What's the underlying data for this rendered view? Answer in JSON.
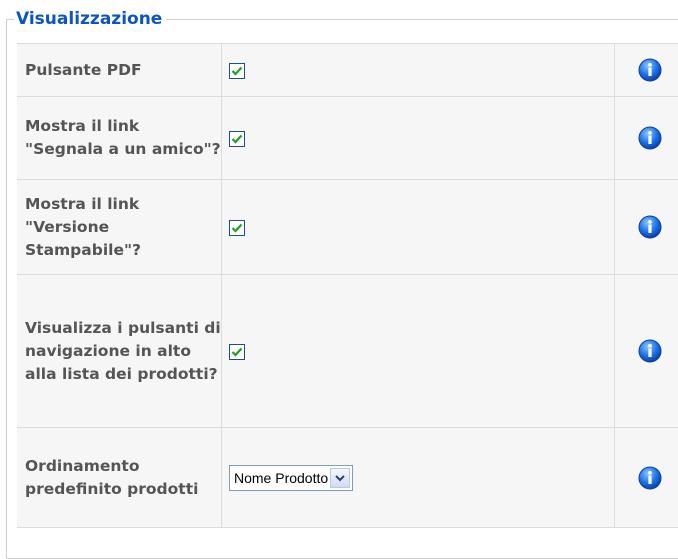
{
  "section": {
    "legend": "Visualizzazione"
  },
  "rows": [
    {
      "label": "Pulsante PDF",
      "control": "checkbox",
      "checked": true,
      "info_icon": "info-icon"
    },
    {
      "label": "Mostra il link \"Segnala a un amico\"?",
      "control": "checkbox",
      "checked": true,
      "info_icon": "info-icon"
    },
    {
      "label": "Mostra il link \"Versione Stampabile\"?",
      "control": "checkbox",
      "checked": true,
      "info_icon": "info-icon"
    },
    {
      "label": "Visualizza i pulsanti di navigazione in alto alla lista dei prodotti?",
      "control": "checkbox",
      "checked": true,
      "info_icon": "info-icon"
    },
    {
      "label": "Ordinamento predefinito prodotti",
      "control": "select",
      "selected": "Nome Prodotto",
      "info_icon": "info-icon"
    }
  ],
  "colors": {
    "legend": "#0b55c4",
    "label_text": "#555555",
    "row_background": "#f6f6f6",
    "check_mark": "#21a121",
    "info_icon_blue": "#1a73e8"
  }
}
